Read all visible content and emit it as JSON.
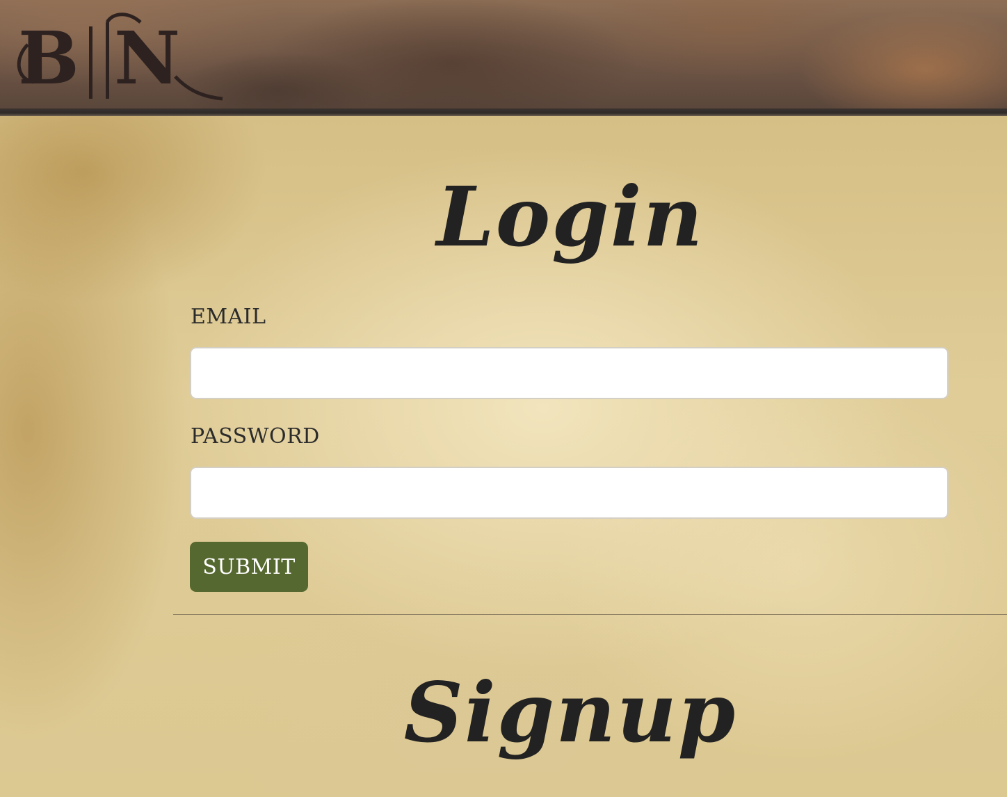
{
  "header": {
    "logo_text": "B||N",
    "colors": {
      "leather": "#6f5646",
      "border": "#2f2a28",
      "logo": "#2e2220"
    }
  },
  "login": {
    "title": "Login",
    "email_label": "EMAIL",
    "email_value": "",
    "email_placeholder": "",
    "password_label": "PASSWORD",
    "password_value": "",
    "password_placeholder": "",
    "submit_label": "SUBMIT",
    "submit_color": "#55682f"
  },
  "signup": {
    "title": "Signup"
  }
}
